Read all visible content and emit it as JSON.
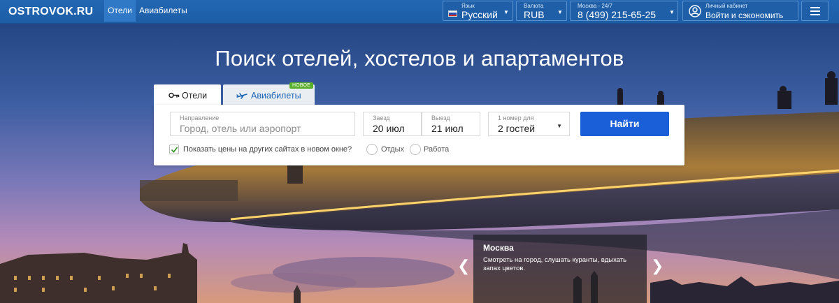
{
  "header": {
    "logo": "OSTROVOK.RU",
    "nav": {
      "hotels": "Отели",
      "avia": "Авиабилеты"
    },
    "language": {
      "caption": "Язык",
      "value": "Русский"
    },
    "currency": {
      "caption": "Валюта",
      "value": "RUB"
    },
    "phone": {
      "caption": "Москва - 24/7",
      "value": "8 (499) 215-65-25"
    },
    "account": {
      "caption": "Личный кабинет",
      "value": "Войти и сэкономить"
    }
  },
  "hero": {
    "headline": "Поиск отелей, хостелов и апартаментов"
  },
  "search": {
    "tabs": {
      "hotels": "Отели",
      "avia": "Авиабилеты",
      "new_badge": "НОВОЕ"
    },
    "destination": {
      "caption": "Направление",
      "placeholder": "Город, отель или аэропорт"
    },
    "checkin": {
      "caption": "Заезд",
      "value": "20 июл"
    },
    "checkout": {
      "caption": "Выезд",
      "value": "21 июл"
    },
    "guests": {
      "caption": "1 номер для",
      "value": "2 гостей"
    },
    "find_label": "Найти",
    "other_sites": {
      "label": "Показать цены на других сайтах в новом окне?",
      "checked": true
    },
    "trip_type": [
      "Отдых",
      "Работа"
    ]
  },
  "destination_card": {
    "title": "Москва",
    "text": "Смотреть на город, слушать куранты, вдыхать запах цветов."
  },
  "colors": {
    "header": "#2267b4",
    "accent": "#1a5fd8",
    "badge": "#5bb02b",
    "check": "#3a9a2a"
  },
  "icons": [
    "key-icon",
    "plane-icon",
    "user-icon",
    "menu-icon",
    "chevron-left-icon",
    "chevron-right-icon",
    "flag-icon",
    "caret-down-icon",
    "checkmark-icon"
  ]
}
